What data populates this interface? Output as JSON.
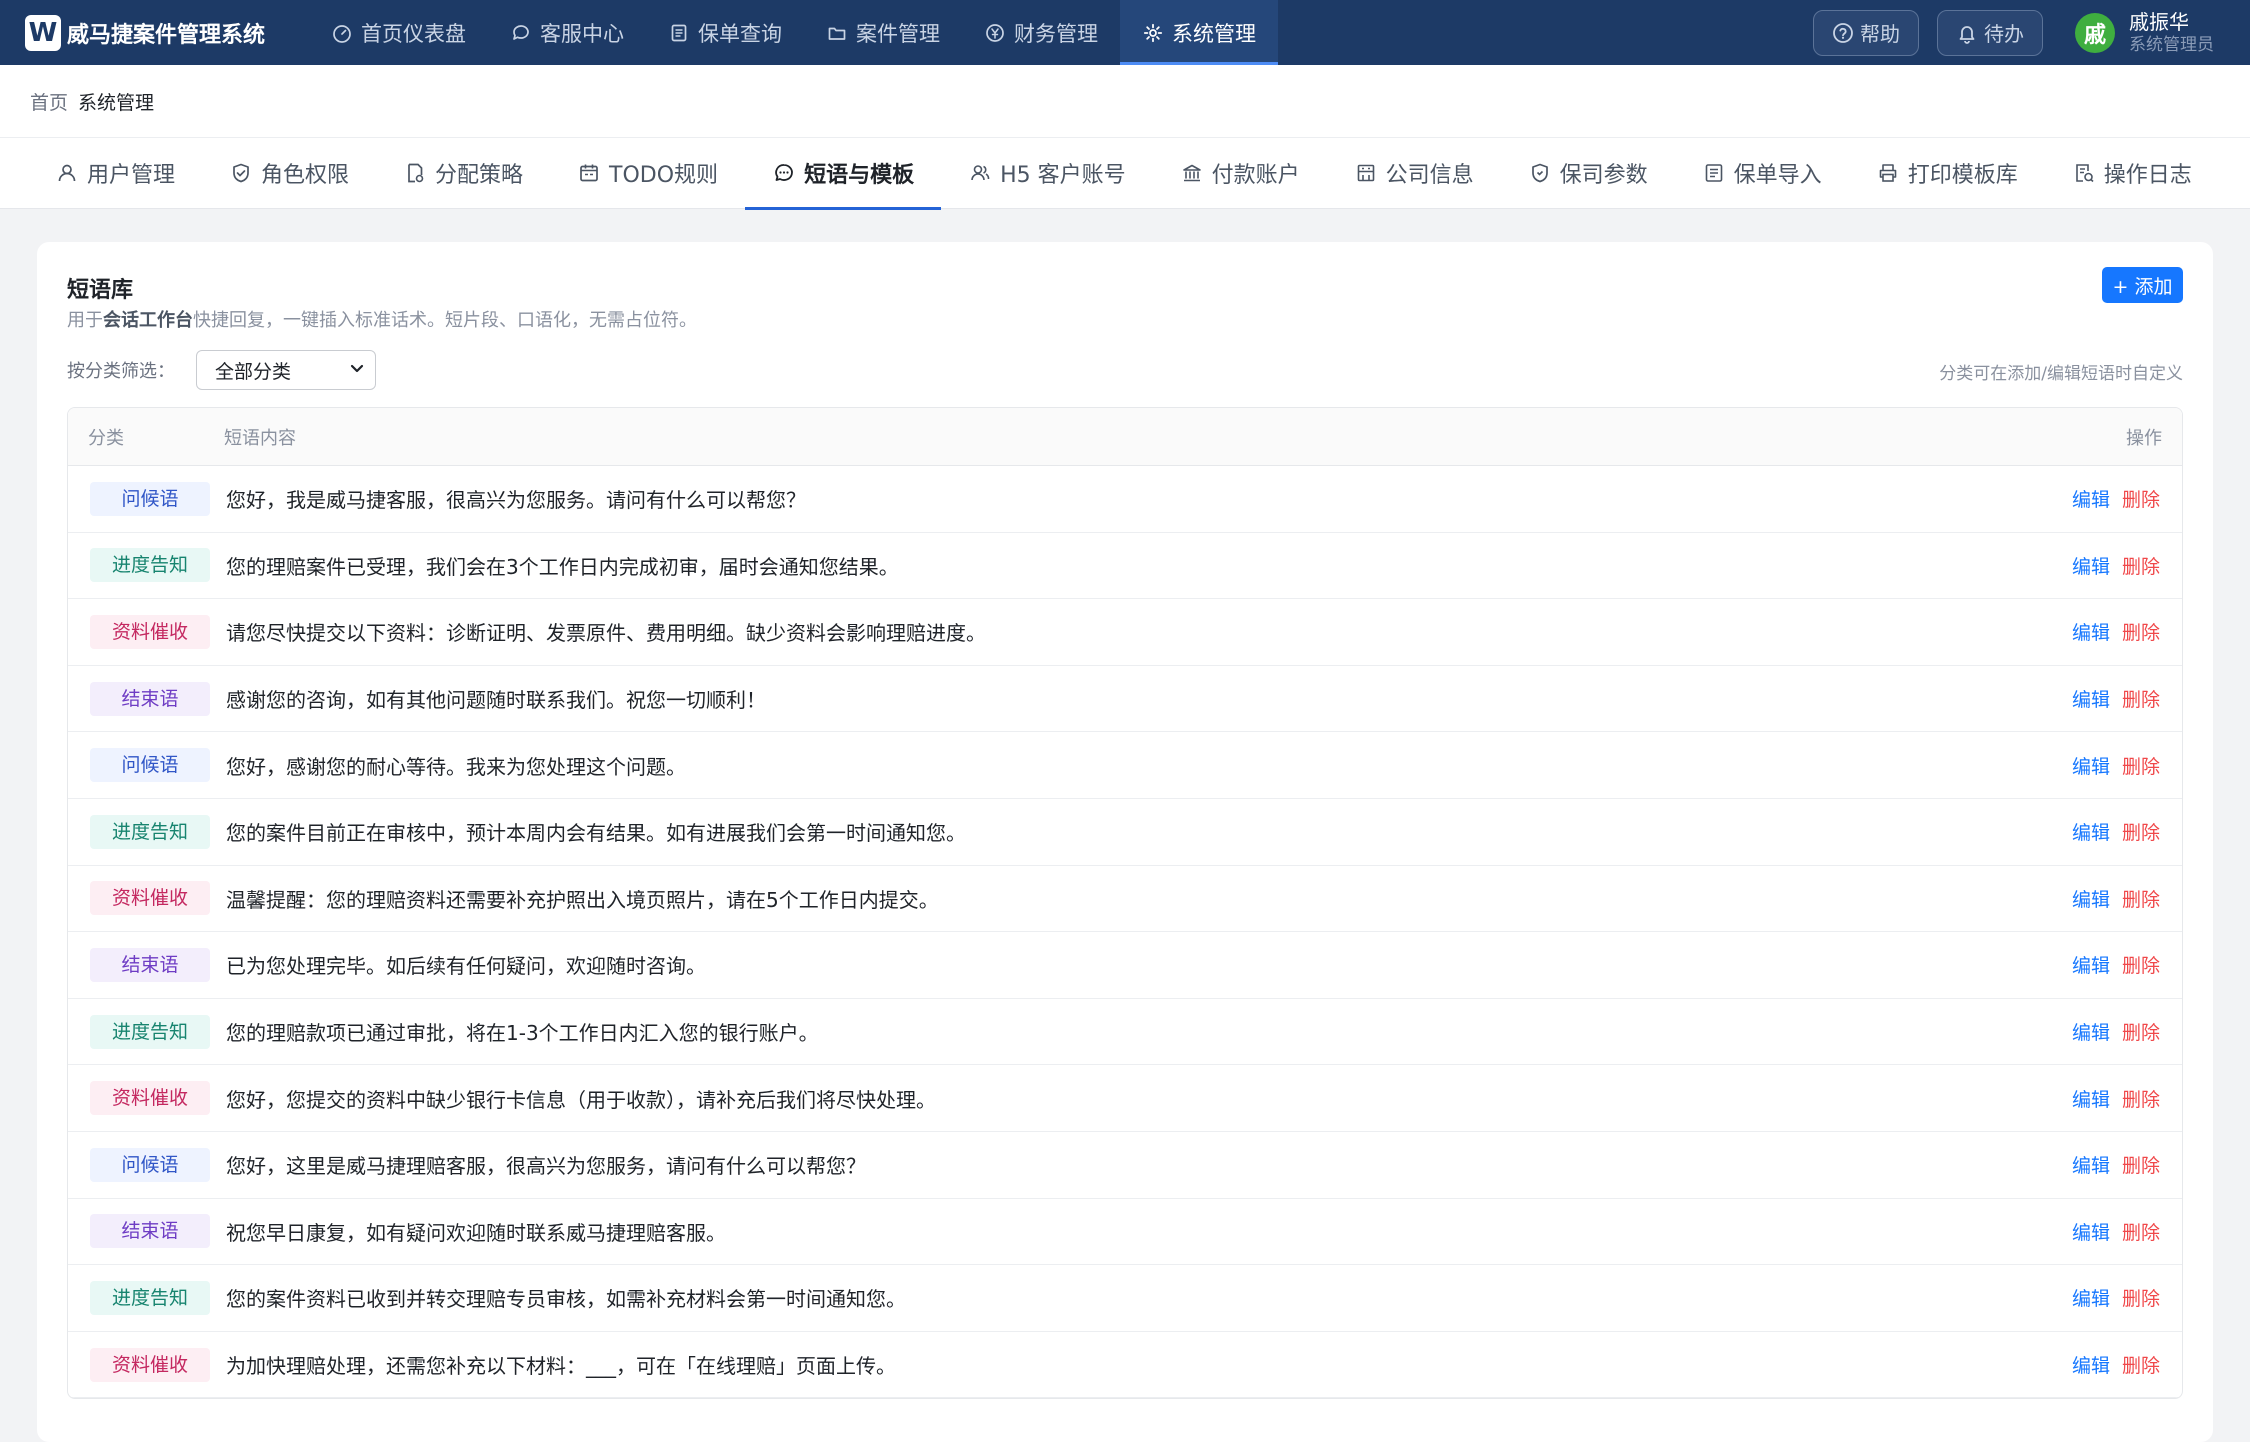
{
  "app": {
    "logo_letter": "W",
    "title": "威马捷案件管理系统"
  },
  "nav": [
    {
      "label": "首页仪表盘",
      "icon": "dashboard-icon"
    },
    {
      "label": "客服中心",
      "icon": "chat-icon"
    },
    {
      "label": "保单查询",
      "icon": "document-icon"
    },
    {
      "label": "案件管理",
      "icon": "folder-icon"
    },
    {
      "label": "财务管理",
      "icon": "money-icon"
    },
    {
      "label": "系统管理",
      "icon": "gear-icon",
      "active": true
    }
  ],
  "header": {
    "help_label": "帮助",
    "todo_label": "待办",
    "user_avatar": "戚",
    "user_name": "戚振华",
    "user_role": "系统管理员"
  },
  "breadcrumb": {
    "home": "首页",
    "current": "系统管理"
  },
  "subtabs": [
    {
      "label": "用户管理",
      "icon": "user-icon"
    },
    {
      "label": "角色权限",
      "icon": "shield-check-icon"
    },
    {
      "label": "分配策略",
      "icon": "assign-icon"
    },
    {
      "label": "TODO规则",
      "icon": "calendar-icon"
    },
    {
      "label": "短语与模板",
      "icon": "chat-bubble-icon",
      "active": true
    },
    {
      "label": "H5 客户账号",
      "icon": "users-icon"
    },
    {
      "label": "付款账户",
      "icon": "bank-icon"
    },
    {
      "label": "公司信息",
      "icon": "building-icon"
    },
    {
      "label": "保司参数",
      "icon": "shield-icon"
    },
    {
      "label": "保单导入",
      "icon": "list-icon"
    },
    {
      "label": "打印模板库",
      "icon": "printer-icon"
    },
    {
      "label": "操作日志",
      "icon": "log-icon"
    }
  ],
  "card": {
    "title": "短语库",
    "desc_prefix": "用于",
    "desc_bold": "会话工作台",
    "desc_suffix": "快捷回复，一键插入标准话术。短片段、口语化，无需占位符。",
    "add_label": "+ 添加",
    "filter_label": "按分类筛选：",
    "filter_value": "全部分类",
    "filter_hint": "分类可在添加/编辑短语时自定义"
  },
  "table": {
    "col_category": "分类",
    "col_content": "短语内容",
    "col_ops": "操作",
    "edit_label": "编辑",
    "delete_label": "删除",
    "rows": [
      {
        "category": "问候语",
        "type": "greet",
        "content": "您好，我是威马捷客服，很高兴为您服务。请问有什么可以帮您？"
      },
      {
        "category": "进度告知",
        "type": "progress",
        "content": "您的理赔案件已受理，我们会在3个工作日内完成初审，届时会通知您结果。"
      },
      {
        "category": "资料催收",
        "type": "urge",
        "content": "请您尽快提交以下资料：诊断证明、发票原件、费用明细。缺少资料会影响理赔进度。"
      },
      {
        "category": "结束语",
        "type": "end",
        "content": "感谢您的咨询，如有其他问题随时联系我们。祝您一切顺利！"
      },
      {
        "category": "问候语",
        "type": "greet",
        "content": "您好，感谢您的耐心等待。我来为您处理这个问题。"
      },
      {
        "category": "进度告知",
        "type": "progress",
        "content": "您的案件目前正在审核中，预计本周内会有结果。如有进展我们会第一时间通知您。"
      },
      {
        "category": "资料催收",
        "type": "urge",
        "content": "温馨提醒：您的理赔资料还需要补充护照出入境页照片，请在5个工作日内提交。"
      },
      {
        "category": "结束语",
        "type": "end",
        "content": "已为您处理完毕。如后续有任何疑问，欢迎随时咨询。"
      },
      {
        "category": "进度告知",
        "type": "progress",
        "content": "您的理赔款项已通过审批，将在1-3个工作日内汇入您的银行账户。"
      },
      {
        "category": "资料催收",
        "type": "urge",
        "content": "您好，您提交的资料中缺少银行卡信息（用于收款），请补充后我们将尽快处理。"
      },
      {
        "category": "问候语",
        "type": "greet",
        "content": "您好，这里是威马捷理赔客服，很高兴为您服务，请问有什么可以帮您？"
      },
      {
        "category": "结束语",
        "type": "end",
        "content": "祝您早日康复，如有疑问欢迎随时联系威马捷理赔客服。"
      },
      {
        "category": "进度告知",
        "type": "progress",
        "content": "您的案件资料已收到并转交理赔专员审核，如需补充材料会第一时间通知您。"
      },
      {
        "category": "资料催收",
        "type": "urge",
        "content": "为加快理赔处理，还需您补充以下材料：___，可在「在线理赔」页面上传。"
      }
    ]
  }
}
